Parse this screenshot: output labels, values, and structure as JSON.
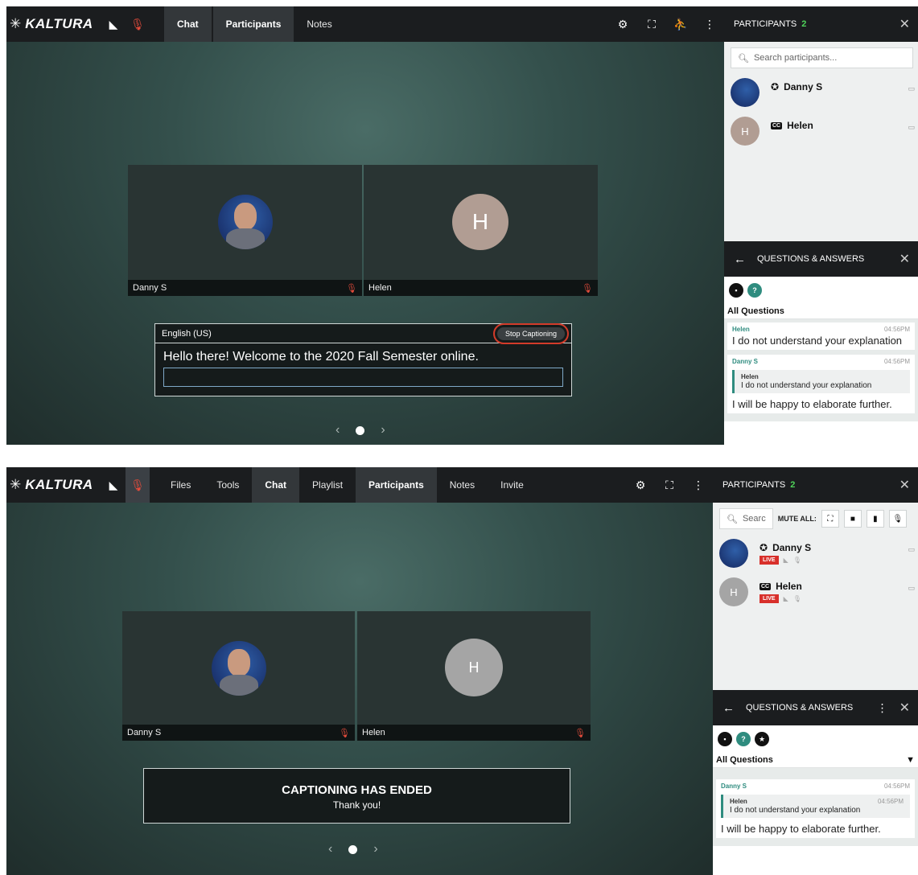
{
  "brand": {
    "logo_text": "KALTURA"
  },
  "top": {
    "tabs": [
      {
        "label": "Chat"
      },
      {
        "label": "Participants"
      },
      {
        "label": "Notes"
      }
    ],
    "tiles": [
      {
        "name": "Danny S"
      },
      {
        "name": "Helen",
        "initial": "H"
      }
    ],
    "caption": {
      "language": "English (US)",
      "stop_label": "Stop Captioning",
      "text": "Hello there! Welcome to the 2020 Fall Semester online."
    },
    "participants": {
      "title": "PARTICIPANTS",
      "count": "2",
      "search_placeholder": "Search participants...",
      "list": [
        {
          "name": "Danny S"
        },
        {
          "name": "Helen",
          "initial": "H",
          "cc": "CC"
        }
      ]
    },
    "qa": {
      "title": "QUESTIONS & ANSWERS",
      "section": "All Questions",
      "q1": {
        "author": "Helen",
        "time": "04:56PM",
        "text": "I do not understand your explanation"
      },
      "q2": {
        "author": "Danny S",
        "time": "04:56PM",
        "quote_author": "Helen",
        "quote_text": "I do not understand your explanation",
        "text": "I will be happy to elaborate further."
      }
    }
  },
  "bottom": {
    "tabs": [
      {
        "label": "Files"
      },
      {
        "label": "Tools"
      },
      {
        "label": "Chat"
      },
      {
        "label": "Playlist"
      },
      {
        "label": "Participants"
      },
      {
        "label": "Notes"
      },
      {
        "label": "Invite"
      }
    ],
    "tiles": [
      {
        "name": "Danny S"
      },
      {
        "name": "Helen",
        "initial": "H"
      }
    ],
    "ended": {
      "title": "CAPTIONING HAS ENDED",
      "sub": "Thank you!"
    },
    "participants": {
      "title": "PARTICIPANTS",
      "count": "2",
      "search_placeholder": "Searc",
      "mute_all_label": "MUTE ALL:",
      "list": [
        {
          "name": "Danny S",
          "live": "LIVE"
        },
        {
          "name": "Helen",
          "initial": "H",
          "cc": "CC",
          "live": "LIVE"
        }
      ]
    },
    "qa": {
      "title": "QUESTIONS & ANSWERS",
      "section": "All Questions",
      "q2": {
        "author": "Danny S",
        "time": "04:56PM",
        "quote_author": "Helen",
        "quote_time": "04:56PM",
        "quote_text": "I do not understand your explanation",
        "text": "I will be happy to elaborate further."
      }
    }
  },
  "colors": {
    "accent_green": "#4fd35a",
    "live_red": "#d8302b",
    "qa_teal": "#2f8c7f",
    "highlight_red": "#d33b2a"
  }
}
